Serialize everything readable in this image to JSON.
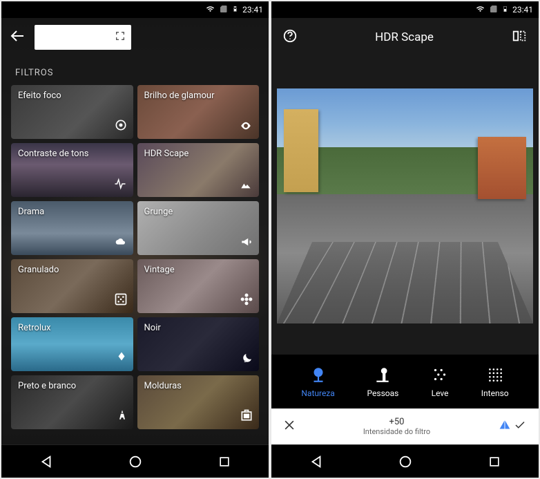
{
  "status": {
    "time": "23:41"
  },
  "left": {
    "section_title": "FILTROS",
    "filters": [
      {
        "label": "Efeito foco"
      },
      {
        "label": "Brilho de glamour"
      },
      {
        "label": "Contraste de tons"
      },
      {
        "label": "HDR Scape"
      },
      {
        "label": "Drama"
      },
      {
        "label": "Grunge"
      },
      {
        "label": "Granulado"
      },
      {
        "label": "Vintage"
      },
      {
        "label": "Retrolux"
      },
      {
        "label": "Noir"
      },
      {
        "label": "Preto e branco"
      },
      {
        "label": "Molduras"
      }
    ]
  },
  "right": {
    "title": "HDR Scape",
    "presets": [
      {
        "label": "Natureza",
        "active": true
      },
      {
        "label": "Pessoas",
        "active": false
      },
      {
        "label": "Leve",
        "active": false
      },
      {
        "label": "Intenso",
        "active": false
      }
    ],
    "intensity_value": "+50",
    "intensity_label": "Intensidade do filtro"
  }
}
